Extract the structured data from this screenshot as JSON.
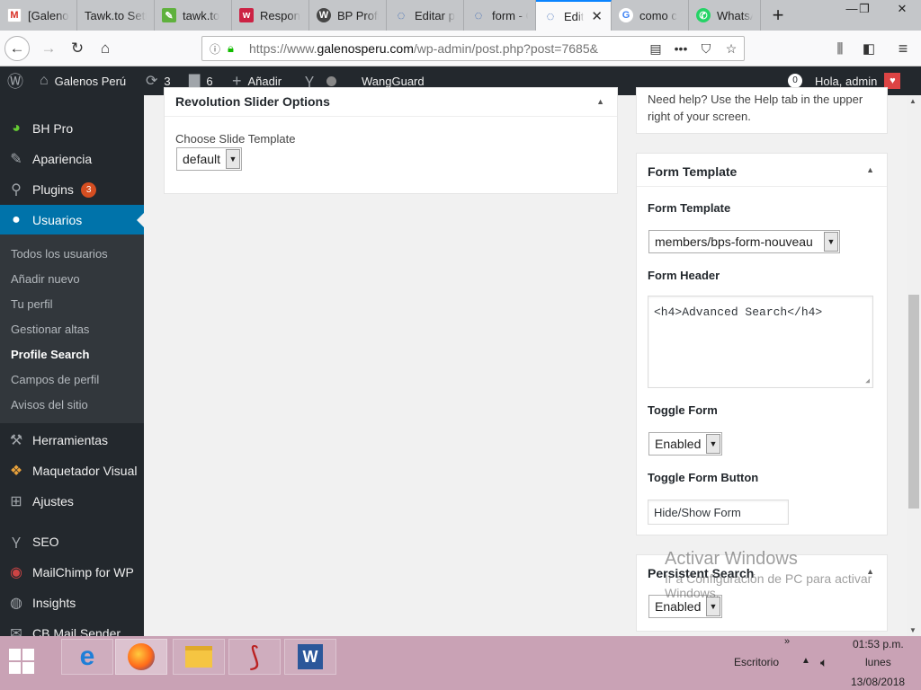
{
  "browser": {
    "tabs": [
      {
        "label": "[Galeno",
        "icon": "gmail-icon",
        "color": "#d93025",
        "glyph": "M"
      },
      {
        "label": "Tawk.to Sett",
        "icon": "tawk-icon",
        "color": "#03a84e",
        "glyph": ""
      },
      {
        "label": "tawk.to",
        "icon": "tawk-leaf-icon",
        "color": "#5fb13d",
        "glyph": "✎"
      },
      {
        "label": "Respon",
        "icon": "wufoo-icon",
        "color": "#cc2244",
        "glyph": "w"
      },
      {
        "label": "BP Profi",
        "icon": "wordpress-icon",
        "color": "#464646",
        "glyph": "W"
      },
      {
        "label": "Editar p",
        "icon": "loading-icon",
        "color": "#2a5db0",
        "glyph": "◌"
      },
      {
        "label": "form - C",
        "icon": "loading-icon",
        "color": "#2a5db0",
        "glyph": "◌"
      },
      {
        "label": "Edit",
        "icon": "loading-icon",
        "color": "#2a5db0",
        "glyph": "◌"
      },
      {
        "label": "como c",
        "icon": "google-icon",
        "color": "#4285f4",
        "glyph": "G"
      },
      {
        "label": "WhatsA",
        "icon": "whatsapp-icon",
        "color": "#25d366",
        "glyph": "✆"
      }
    ],
    "new_tab": "+",
    "url_domain_prefix": "https://www.",
    "url_domain": "galenosperu.com",
    "url_path": "/wp-admin/post.php?post=7685&",
    "window_controls": [
      "—",
      "❐",
      "✕"
    ]
  },
  "adminbar": {
    "site_name": "Galenos Perú",
    "updates_count": "3",
    "comments_count": "6",
    "add_new": "Añadir",
    "wangguard": "WangGuard",
    "notifications_count": "0",
    "greeting": "Hola, admin"
  },
  "sidebar": {
    "items": [
      {
        "label": "BH Pro",
        "icon": "bh-pro-icon"
      },
      {
        "label": "Apariencia",
        "icon": "paintbrush-icon"
      },
      {
        "label": "Plugins",
        "icon": "plugin-icon",
        "badge": "3"
      },
      {
        "label": "Usuarios",
        "icon": "users-icon"
      },
      {
        "label": "Herramientas",
        "icon": "tools-icon"
      },
      {
        "label": "Maquetador Visual",
        "icon": "visual-builder-icon"
      },
      {
        "label": "Ajustes",
        "icon": "settings-icon"
      },
      {
        "label": "SEO",
        "icon": "yoast-icon"
      },
      {
        "label": "MailChimp for WP",
        "icon": "mailchimp-icon"
      },
      {
        "label": "Insights",
        "icon": "insights-icon"
      },
      {
        "label": "CB Mail Sender",
        "icon": "mail-sender-icon"
      }
    ],
    "submenu": [
      "Todos los usuarios",
      "Añadir nuevo",
      "Tu perfil",
      "Gestionar altas",
      "Profile Search",
      "Campos de perfil",
      "Avisos del sitio"
    ],
    "submenu_current_index": 4
  },
  "revolution_box": {
    "title": "Revolution Slider Options",
    "field_label": "Choose Slide Template",
    "select_value": "default"
  },
  "help_box": {
    "text_line1": "Need help? Use the Help tab in the upper",
    "text_line2": "right of your screen."
  },
  "form_template_box": {
    "title": "Form Template",
    "form_template_label": "Form Template",
    "form_template_value": "members/bps-form-nouveau",
    "form_header_label": "Form Header",
    "form_header_value": "<h4>Advanced Search</h4>",
    "toggle_form_label": "Toggle Form",
    "toggle_form_value": "Enabled",
    "toggle_button_label": "Toggle Form Button",
    "toggle_button_value": "Hide/Show Form"
  },
  "persistent_box": {
    "title": "Persistent Search",
    "select_value": "Enabled"
  },
  "watermark": {
    "title": "Activar Windows",
    "line1": "Ir a Configuración de PC para activar",
    "line2": "Windows."
  },
  "taskbar": {
    "apps": [
      {
        "name": "ie-icon"
      },
      {
        "name": "firefox-icon"
      },
      {
        "name": "file-explorer-icon"
      },
      {
        "name": "filezilla-icon"
      },
      {
        "name": "word-icon"
      }
    ],
    "desktop_label": "Escritorio",
    "time": "01:53 p.m.",
    "day": "lunes",
    "date": "13/08/2018"
  },
  "colors": {
    "wp_blue": "#0073aa",
    "wp_dark": "#23282d",
    "plugin_badge": "#d54e21",
    "taskbar": "#c9a2b5",
    "active_tab_indicator": "#0a84ff"
  }
}
